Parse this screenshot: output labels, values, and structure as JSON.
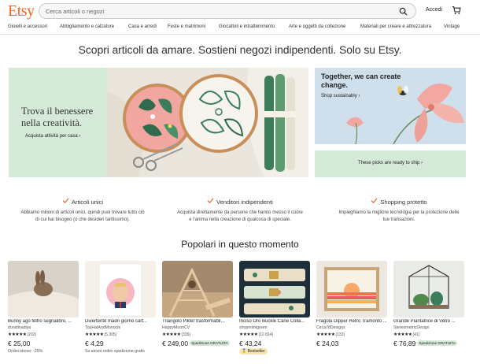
{
  "brand": {
    "logo_text": "Etsy",
    "accent": "#f1641e"
  },
  "search": {
    "placeholder": "Cerca articoli o negozi",
    "icon": "search-icon"
  },
  "header": {
    "signin_label": "Accedi",
    "cart_icon": "cart-icon"
  },
  "nav": {
    "items": [
      "Gioielli e accessori",
      "Abbigliamento e calzature",
      "Casa e arredi",
      "Feste e matrimoni",
      "Giocattoli e intrattenimento",
      "Arte e oggetti da collezione",
      "Materiali per creare e attrezzatura",
      "Vintage"
    ]
  },
  "tagline": "Scopri articoli da amare. Sostieni negozi indipendenti. Solo su Etsy.",
  "hero": {
    "left_title": "Trova il benessere nella creatività.",
    "left_link": "Acquista attività per casa",
    "right_title": "Together, we can create change.",
    "right_link": "Shop sustainably",
    "right2_text": "These picks are ready to ship",
    "colors": {
      "mint": "#d4e9d7",
      "sky": "#cfe0ec"
    }
  },
  "features": [
    {
      "title": "Articoli unici",
      "desc": "Abbiamo milioni di articoli unici, quindi puoi trovare tutto ciò di cui hai bisogno (o che desideri tantissimo)."
    },
    {
      "title": "Venditori indipendenti",
      "desc": "Acquista direttamente da persone che hanno messo il cuore e l'anima nella creazione di qualcosa di speciale."
    },
    {
      "title": "Shopping protetto",
      "desc": "Impieghiamo la migliore tecnologia per la protezione delle tue transazioni."
    }
  ],
  "section_title": "Popolari in questo momento",
  "stars": "★★★★★",
  "products": [
    {
      "title": "Bunny ago feltro segnalibro, ...",
      "shop": "donidinadiya",
      "reviews": "(202)",
      "price": "€ 25,00",
      "badge": "",
      "note": "Ordini idonei: -25%",
      "bestseller": ""
    },
    {
      "title": "Divertente madri giorno cart...",
      "shop": "TopHatAndMonocle",
      "reviews": "(5.305)",
      "price": "€ 4,29",
      "badge": "",
      "note": "Su alcuni ordini spedizione gratis",
      "bestseller": ""
    },
    {
      "title": "Triangolo Pikler trasformabil...",
      "shop": "HappyMoonCV",
      "reviews": "(336)",
      "price": "€ 249,00",
      "badge": "Spedizione GRATUITA",
      "note": "",
      "bestseller": ""
    },
    {
      "title": "Inciso Oro Buckle Cane Colla...",
      "shop": "shopmimigreen",
      "reviews": "(12.814)",
      "price": "€ 43,24",
      "badge": "",
      "note": "",
      "bestseller": "Bestseller"
    },
    {
      "title": "Fragola Dipper Retro Tramonto ...",
      "shop": "Circa78Designs",
      "reviews": "(133)",
      "price": "€ 24,03",
      "badge": "",
      "note": "",
      "bestseller": ""
    },
    {
      "title": "Grande Piantatrice di Vetro ...",
      "shop": "StereometricDesign",
      "reviews": "(41)",
      "price": "€ 76,89",
      "badge": "Spedizione GRATUITA",
      "note": "",
      "bestseller": ""
    }
  ]
}
